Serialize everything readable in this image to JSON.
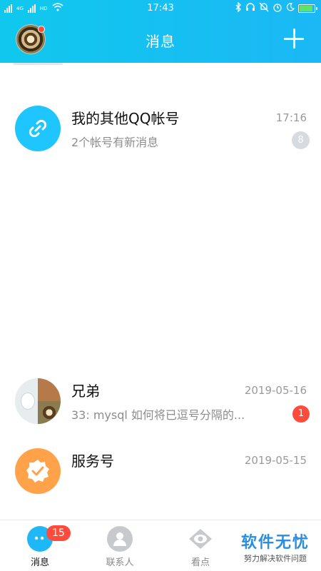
{
  "status_bar": {
    "time": "17:43",
    "carrier_1": "4G",
    "carrier_2": "HD"
  },
  "header": {
    "title": "消息"
  },
  "conversations": [
    {
      "name": "我的其他QQ帐号",
      "time": "17:16",
      "preview": "2个帐号有新消息",
      "badge": "8",
      "icon": "link-icon"
    },
    {
      "name": "兄弟",
      "time": "2019-05-16",
      "preview": "33: mysql 如何将已逗号分隔的...",
      "badge": "1",
      "icon": "group-avatar"
    },
    {
      "name": "服务号",
      "time": "2019-05-15",
      "preview": "",
      "icon": "verified-badge-icon"
    }
  ],
  "tabbar": {
    "messages_label": "消息",
    "messages_badge": "15",
    "contacts_label": "联系人",
    "watch_label": "看点"
  },
  "watermark": {
    "line1": "软件无忧",
    "line2": "努力解决软件问题"
  },
  "colors": {
    "header": "#1bb8f5",
    "badge_red": "#ff4b3b",
    "link_icon_bg": "#1ec5ff",
    "service_icon_bg": "#ffa24a"
  }
}
